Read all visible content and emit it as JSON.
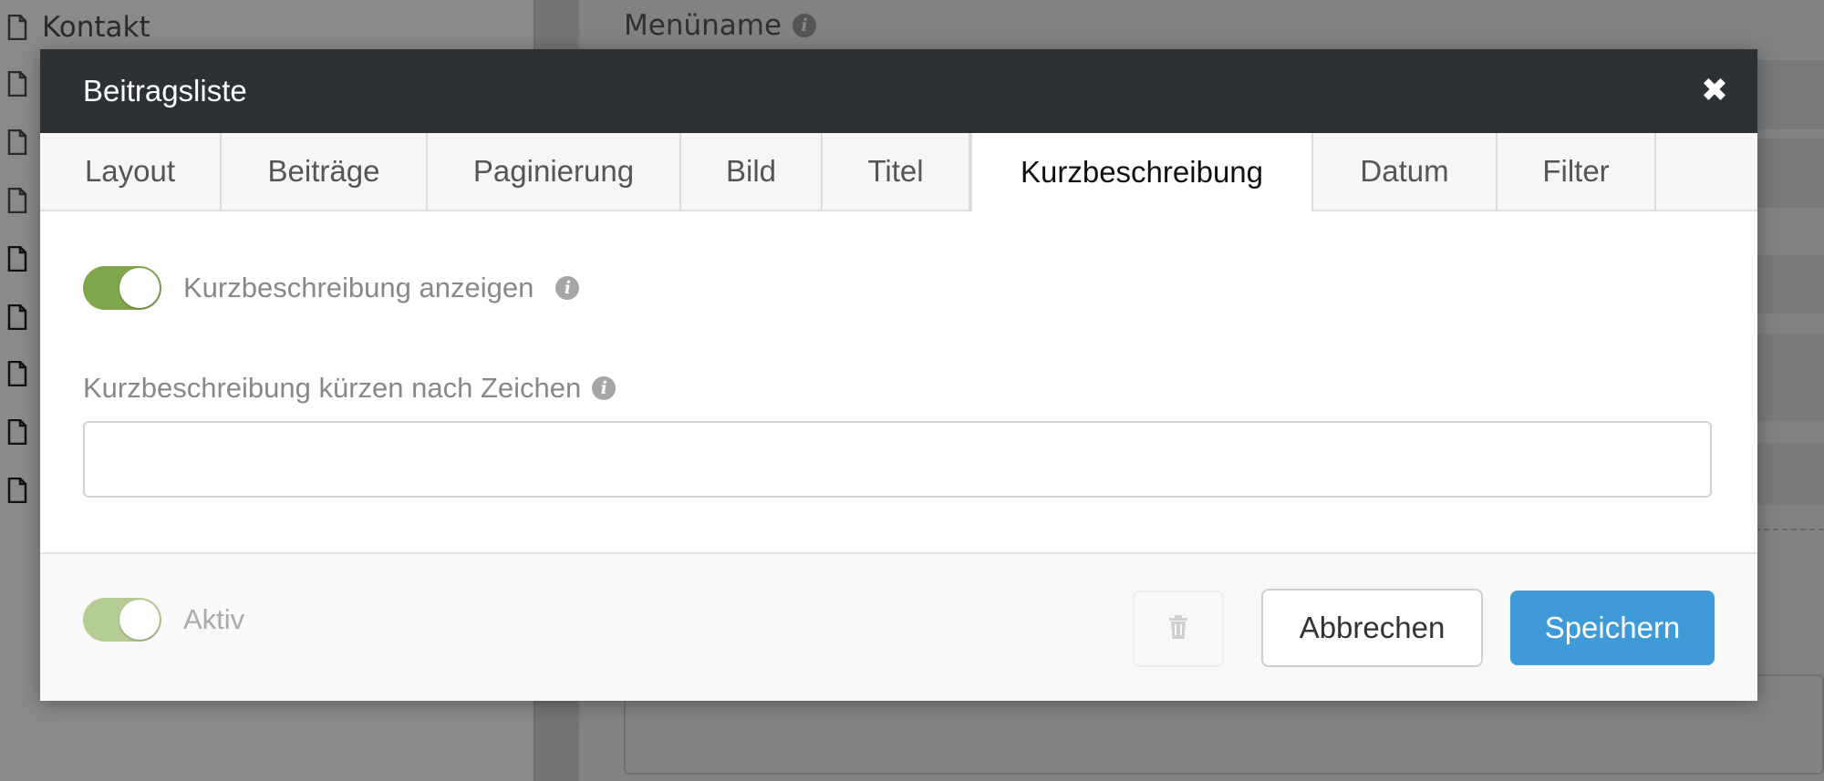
{
  "background": {
    "sidebar_items": [
      "Kontakt",
      "",
      "",
      "",
      "",
      "",
      "",
      "",
      ""
    ],
    "field_label": "Menüname"
  },
  "modal": {
    "title": "Beitragsliste",
    "close_icon": "close-icon",
    "tabs": [
      {
        "label": "Layout",
        "active": false
      },
      {
        "label": "Beiträge",
        "active": false
      },
      {
        "label": "Paginierung",
        "active": false
      },
      {
        "label": "Bild",
        "active": false
      },
      {
        "label": "Titel",
        "active": false
      },
      {
        "label": "Kurzbeschreibung",
        "active": true
      },
      {
        "label": "Datum",
        "active": false
      },
      {
        "label": "Filter",
        "active": false
      }
    ],
    "show_excerpt": {
      "label": "Kurzbeschreibung anzeigen",
      "value": true
    },
    "truncate": {
      "label": "Kurzbeschreibung kürzen nach Zeichen",
      "value": ""
    },
    "footer": {
      "active_label": "Aktiv",
      "active_value": true,
      "cancel_label": "Abbrechen",
      "save_label": "Speichern"
    }
  },
  "colors": {
    "header_bg": "#2c3135",
    "toggle_on": "#7fa64a",
    "primary": "#3f9bd8"
  }
}
